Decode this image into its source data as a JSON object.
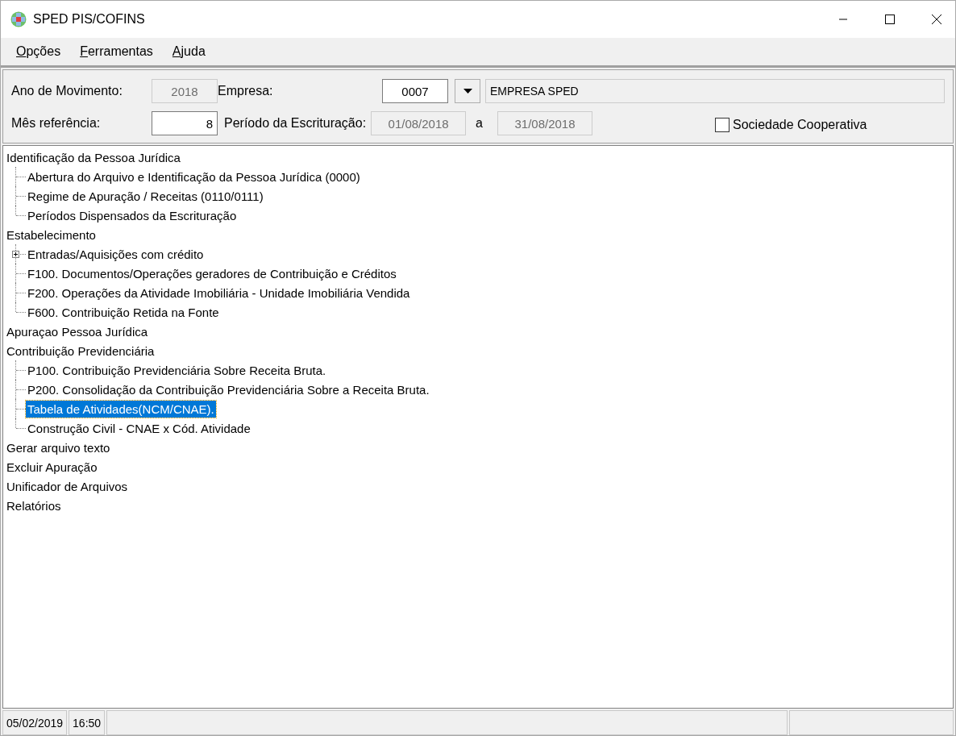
{
  "window": {
    "title": "SPED PIS/COFINS"
  },
  "menu": [
    {
      "label": "Opções"
    },
    {
      "label": "Ferramentas"
    },
    {
      "label": "Ajuda"
    }
  ],
  "form": {
    "ano_label": "Ano de Movimento:",
    "ano_value": "2018",
    "empresa_label": "Empresa:",
    "empresa_code": "0007",
    "empresa_name": "EMPRESA SPED",
    "mes_label": "Mês referência:",
    "mes_value": "8",
    "periodo_label": "Período da Escrituração:",
    "periodo_start": "01/08/2018",
    "periodo_sep": "a",
    "periodo_end": "31/08/2018",
    "cooperativa": {
      "label": "Sociedade Cooperativa",
      "checked": false
    }
  },
  "tree": [
    {
      "label": "Identificação da Pessoa Jurídica",
      "selected": false,
      "children": [
        {
          "label": "Abertura do Arquivo e Identificação da Pessoa Jurídica (0000)",
          "selected": false,
          "collapsed": false
        },
        {
          "label": "Regime de Apuração / Receitas (0110/0111)",
          "selected": false,
          "collapsed": false
        },
        {
          "label": "Períodos Dispensados da Escrituração",
          "selected": false,
          "collapsed": false
        }
      ]
    },
    {
      "label": "Estabelecimento",
      "selected": false,
      "children": [
        {
          "label": "Entradas/Aquisições com crédito",
          "selected": false,
          "collapsed": true
        },
        {
          "label": "F100. Documentos/Operações geradores de Contribuição e Créditos",
          "selected": false,
          "collapsed": false
        },
        {
          "label": "F200. Operações da Atividade Imobiliária - Unidade Imobiliária Vendida",
          "selected": false,
          "collapsed": false
        },
        {
          "label": "F600. Contribuição Retida na Fonte",
          "selected": false,
          "collapsed": false
        }
      ]
    },
    {
      "label": "Apuraçao Pessoa Jurídica",
      "selected": false
    },
    {
      "label": "Contribuição Previdenciária",
      "selected": false,
      "children": [
        {
          "label": "P100. Contribuição Previdenciária Sobre Receita Bruta.",
          "selected": false,
          "collapsed": false
        },
        {
          "label": "P200. Consolidação da Contribuição Previdenciária Sobre a Receita Bruta.",
          "selected": false,
          "collapsed": false
        },
        {
          "label": "Tabela de Atividades(NCM/CNAE).",
          "selected": true,
          "collapsed": false
        },
        {
          "label": "Construção Civil - CNAE x Cód. Atividade",
          "selected": false,
          "collapsed": false
        }
      ]
    },
    {
      "label": "Gerar arquivo texto",
      "selected": false
    },
    {
      "label": "Excluir Apuração",
      "selected": false
    },
    {
      "label": "Unificador de Arquivos",
      "selected": false
    },
    {
      "label": "Relatórios",
      "selected": false
    }
  ],
  "status_bar": {
    "date": "05/02/2019",
    "time": "16:50"
  }
}
